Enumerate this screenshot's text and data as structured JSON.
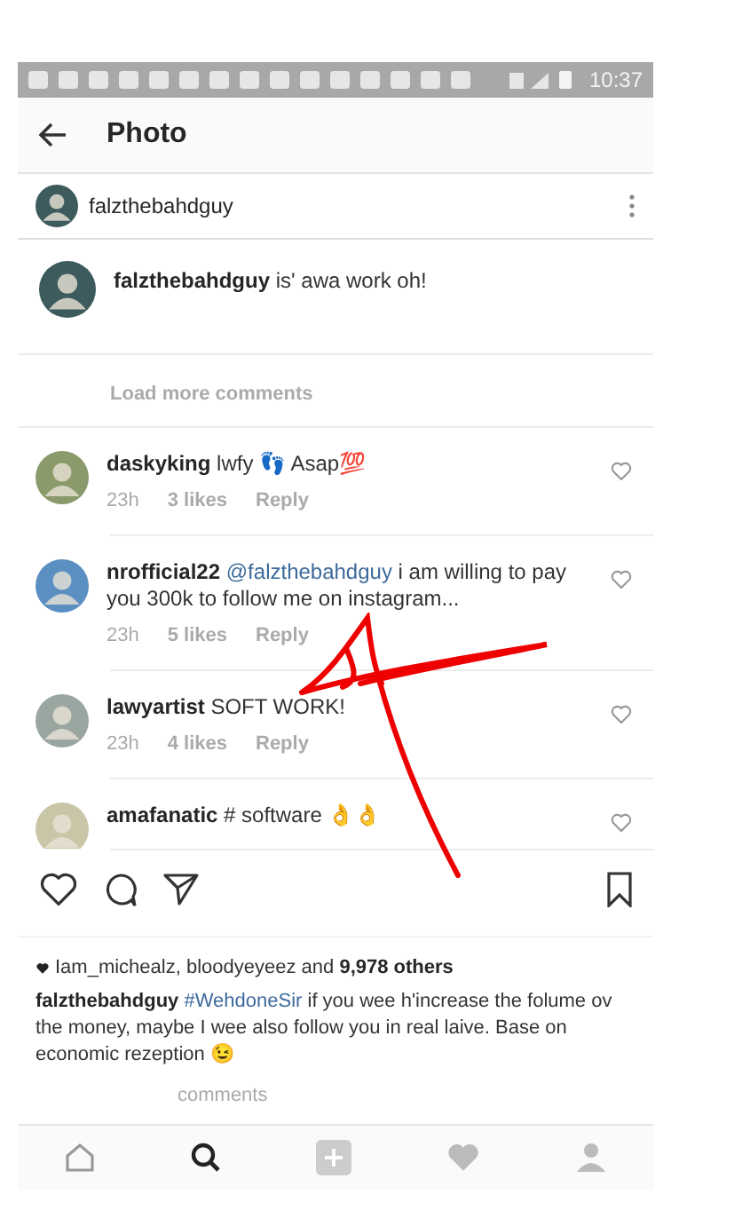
{
  "status_bar": {
    "time": "10:37"
  },
  "header": {
    "title": "Photo"
  },
  "post": {
    "username": "falzthebahdguy"
  },
  "own_comment": {
    "username": "falzthebahdguy",
    "text": "is' awa work oh!"
  },
  "load_more": "Load more comments",
  "comments": [
    {
      "username": "daskyking",
      "text": "lwfy 👣 Asap💯",
      "time": "23h",
      "likes": "3 likes",
      "reply": "Reply",
      "cut": false
    },
    {
      "username": "nrofficial22",
      "mention": "@falzthebahdguy",
      "text": "i am willing to pay you 300k to follow me on instagram...",
      "time": "23h",
      "likes": "5 likes",
      "reply": "Reply",
      "cut": false
    },
    {
      "username": "lawyartist",
      "text": "SOFT WORK!",
      "time": "23h",
      "likes": "4 likes",
      "reply": "Reply",
      "cut": false
    },
    {
      "username": "amafanatic",
      "text": "# software 👌👌",
      "cut": true
    }
  ],
  "likes_line": {
    "names": "Iam_michealz, bloodyeyeez",
    "joiner": "and",
    "count": "9,978 others"
  },
  "caption": {
    "username": "falzthebahdguy",
    "hashtag": "#WehdoneSir",
    "text": "if you wee h'increase the folume ov the money, maybe I wee also follow you in real laive. Base on economic rezeption 😉"
  },
  "view_comments": "comments"
}
